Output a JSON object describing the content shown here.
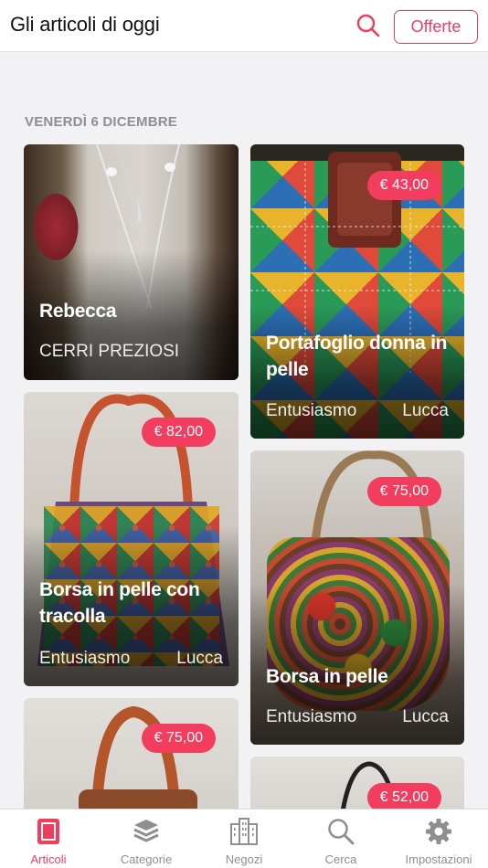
{
  "header": {
    "title": "Gli articoli di oggi",
    "offers_label": "Offerte"
  },
  "date_label": "VENERDÌ 6 DICEMBRE",
  "items": [
    {
      "title": "Rebecca",
      "shop": "CERRI PREZIOSI",
      "city": "",
      "price": ""
    },
    {
      "title": "Portafoglio donna in pelle",
      "shop": "Entusiasmo",
      "city": "Lucca",
      "price": "€ 43,00"
    },
    {
      "title": "Borsa in pelle con tracolla",
      "shop": "Entusiasmo",
      "city": "Lucca",
      "price": "€ 82,00"
    },
    {
      "title": "Borsa in pelle",
      "shop": "Entusiasmo",
      "city": "Lucca",
      "price": "€ 75,00"
    },
    {
      "title": "",
      "shop": "",
      "city": "",
      "price": "€ 75,00"
    },
    {
      "title": "",
      "shop": "",
      "city": "",
      "price": "€ 52,00"
    }
  ],
  "tabs": [
    {
      "label": "Articoli",
      "icon": "article-icon",
      "active": true
    },
    {
      "label": "Categorie",
      "icon": "layers-icon",
      "active": false
    },
    {
      "label": "Negozi",
      "icon": "buildings-icon",
      "active": false
    },
    {
      "label": "Cerca",
      "icon": "search-icon",
      "active": false
    },
    {
      "label": "Impostazioni",
      "icon": "gear-icon",
      "active": false
    }
  ],
  "colors": {
    "accent": "#ef3d5e",
    "price_badge": "#f23d5e",
    "inactive": "#8e8e93"
  }
}
